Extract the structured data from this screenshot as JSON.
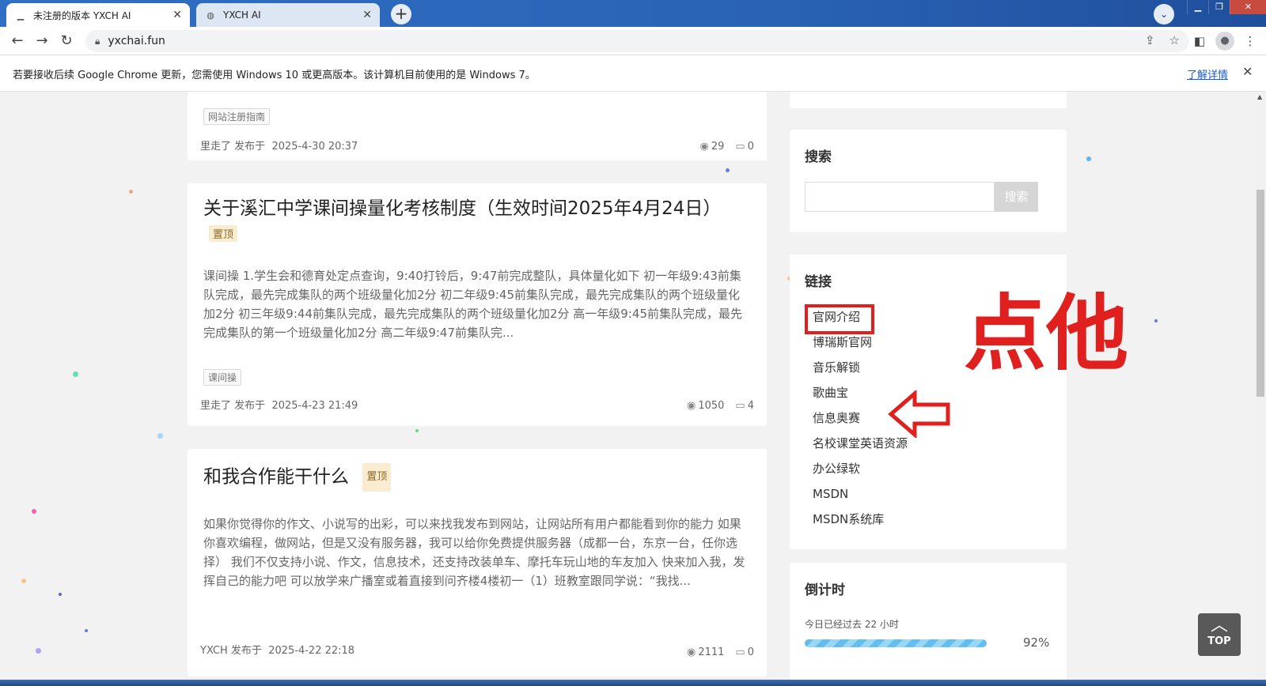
{
  "browser": {
    "tabs": [
      {
        "title": "未注册的版本 YXCH AI",
        "active": true
      },
      {
        "title": "YXCH AI",
        "active": false
      }
    ],
    "url": "yxchai.fun",
    "update_bar": {
      "message": "若要接收后续 Google Chrome 更新，您需使用 Windows 10 或更高版本。该计算机目前使用的是 Windows 7。",
      "link": "了解详情"
    }
  },
  "posts": [
    {
      "tag": "网站注册指南",
      "author": "里走了",
      "published_label": "发布于",
      "date": "2025-4-30 20:37",
      "views": "29",
      "comments": "0"
    },
    {
      "title": "关于溪汇中学课间操量化考核制度（生效时间2025年4月24日）",
      "pin": "置顶",
      "excerpt": "课间操 1.学生会和德育处定点查询，9:40打铃后，9:47前完成整队，具体量化如下 初一年级9:43前集队完成，最先完成集队的两个班级量化加2分 初二年级9:45前集队完成，最先完成集队的两个班级量化加2分 初三年级9:44前集队完成，最先完成集队的两个班级量化加2分 高一年级9:45前集队完成，最先完成集队的第一个班级量化加2分 高二年级9:47前集队完...",
      "tag": "课间操",
      "author": "里走了",
      "published_label": "发布于",
      "date": "2025-4-23 21:49",
      "views": "1050",
      "comments": "4"
    },
    {
      "title": "和我合作能干什么",
      "pin": "置顶",
      "excerpt": "如果你觉得你的作文、小说写的出彩，可以来找我发布到网站，让网站所有用户都能看到你的能力 如果你喜欢编程，做网站，但是又没有服务器，我可以给你免费提供服务器（成都一台，东京一台，任你选择） 我们不仅支持小说、作文，信息技术，还支持改装单车、摩托车玩山地的车友加入 快来加入我，发挥自己的能力吧 可以放学来广播室或着直接到问齐楼4楼初一（1）班教室跟同学说：“我找...",
      "author": "YXCH",
      "published_label": "发布于",
      "date": "2025-4-22 22:18",
      "views": "2111",
      "comments": "0"
    }
  ],
  "sidebar": {
    "search": {
      "heading": "搜索",
      "button": "搜索",
      "placeholder": ""
    },
    "links": {
      "heading": "链接",
      "items": [
        "官网介绍",
        "博瑞斯官网",
        "音乐解锁",
        "歌曲宝",
        "信息奥赛",
        "名校课堂英语资源",
        "办公绿软",
        "MSDN",
        "MSDN系统库"
      ]
    },
    "annotation": "点他",
    "countdown": {
      "heading": "倒计时",
      "label": "今日已经过去 22 小时",
      "percent_text": "92%",
      "progress": 0.92
    }
  },
  "back_to_top": "TOP",
  "colors": {
    "accent_red": "#e0201e",
    "progress_blue": "#62bdf0",
    "pin_bg": "#f9ecd0"
  }
}
